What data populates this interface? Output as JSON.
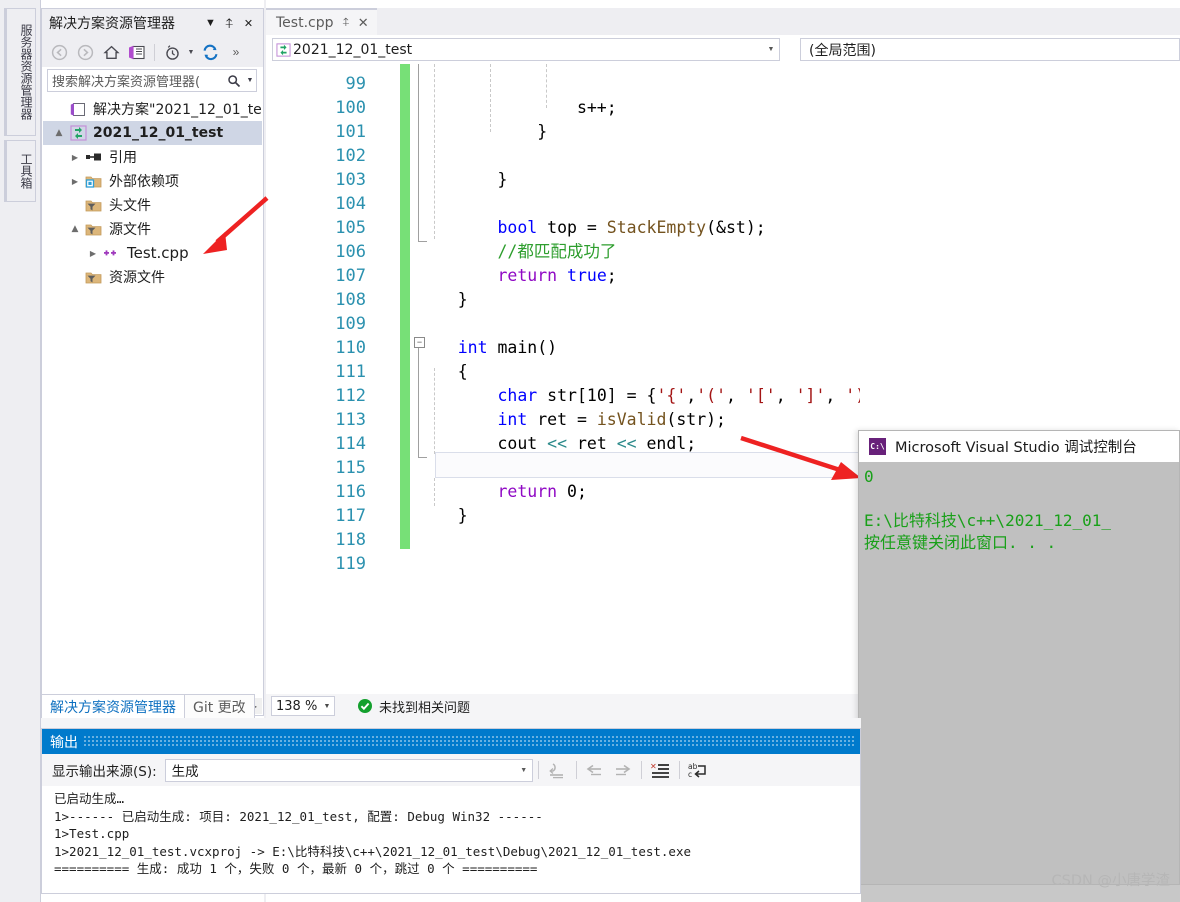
{
  "left_dock": {
    "tabs": [
      {
        "name": "server-explorer",
        "label": "服务器资源管理器"
      },
      {
        "name": "toolbox",
        "label": "工具箱"
      }
    ]
  },
  "solution_explorer": {
    "title": "解决方案资源管理器",
    "header_buttons": [
      {
        "name": "dropdown",
        "glyph": "▼"
      },
      {
        "name": "pin",
        "glyph": "⇱"
      },
      {
        "name": "close",
        "glyph": "✕"
      }
    ],
    "toolbar": [
      {
        "name": "back",
        "glyph": "◀"
      },
      {
        "name": "forward",
        "glyph": "▶"
      },
      {
        "name": "home",
        "glyph": "⌂"
      },
      {
        "name": "solution-view",
        "glyph": "▤"
      },
      {
        "name": "pending-changes",
        "glyph": "◷"
      },
      {
        "name": "refresh",
        "glyph": "⟳"
      },
      {
        "name": "overflow",
        "glyph": "»"
      }
    ],
    "search_placeholder": "搜索解决方案资源管理器(",
    "tree": [
      {
        "label": "解决方案\"2021_12_01_te",
        "icon": "solution-icon",
        "indent": 0,
        "arrow": "",
        "selected": false,
        "bold": false
      },
      {
        "label": "2021_12_01_test",
        "icon": "project-icon",
        "indent": 0,
        "arrow": "▲",
        "selected": true,
        "bold": true
      },
      {
        "label": "引用",
        "icon": "references-icon",
        "indent": 1,
        "arrow": "▶",
        "selected": false,
        "bold": false
      },
      {
        "label": "外部依赖项",
        "icon": "external-deps-icon",
        "indent": 1,
        "arrow": "▶",
        "selected": false,
        "bold": false
      },
      {
        "label": "头文件",
        "icon": "filter-folder-icon",
        "indent": 1,
        "arrow": "",
        "selected": false,
        "bold": false
      },
      {
        "label": "源文件",
        "icon": "filter-folder-icon",
        "indent": 1,
        "arrow": "▲",
        "selected": false,
        "bold": false
      },
      {
        "label": "Test.cpp",
        "icon": "cpp-file-icon",
        "indent": 2,
        "arrow": "▶",
        "selected": false,
        "bold": false
      },
      {
        "label": "资源文件",
        "icon": "filter-folder-icon",
        "indent": 1,
        "arrow": "",
        "selected": false,
        "bold": false
      }
    ]
  },
  "bottom_tabs": [
    {
      "label": "解决方案资源管理器",
      "active": true
    },
    {
      "label": "Git 更改",
      "active": false
    }
  ],
  "status_strip": {
    "zoom_value": "138 %",
    "status_text": "未找到相关问题",
    "status_icon": "check-circle-icon"
  },
  "document_tab": {
    "label": "Test.cpp",
    "pin_glyph": "⇱",
    "close_glyph": "✕"
  },
  "navbar": {
    "project": "2021_12_01_test",
    "scope": "(全局范围)"
  },
  "editor": {
    "first_line": 99,
    "lines": [
      {
        "num": 99,
        "segments": []
      },
      {
        "num": 100,
        "segments": [
          {
            "t": "                s++;",
            "c": "ident"
          }
        ]
      },
      {
        "num": 101,
        "segments": [
          {
            "t": "            }",
            "c": "ident"
          }
        ]
      },
      {
        "num": 102,
        "segments": []
      },
      {
        "num": 103,
        "segments": [
          {
            "t": "        }",
            "c": "ident"
          }
        ]
      },
      {
        "num": 104,
        "segments": []
      },
      {
        "num": 105,
        "segments": [
          {
            "t": "        ",
            "c": "ident"
          },
          {
            "t": "bool",
            "c": "kw"
          },
          {
            "t": " top = ",
            "c": "ident"
          },
          {
            "t": "StackEmpty",
            "c": "fn"
          },
          {
            "t": "(&st);",
            "c": "ident"
          }
        ]
      },
      {
        "num": 106,
        "segments": [
          {
            "t": "        ",
            "c": "ident"
          },
          {
            "t": "//都匹配成功了",
            "c": "cmt"
          }
        ]
      },
      {
        "num": 107,
        "segments": [
          {
            "t": "        ",
            "c": "ident"
          },
          {
            "t": "return",
            "c": "kw2"
          },
          {
            "t": " ",
            "c": "ident"
          },
          {
            "t": "true",
            "c": "kw"
          },
          {
            "t": ";",
            "c": "ident"
          }
        ]
      },
      {
        "num": 108,
        "segments": [
          {
            "t": "    }",
            "c": "ident"
          }
        ]
      },
      {
        "num": 109,
        "segments": []
      },
      {
        "num": 110,
        "segments": [
          {
            "t": "    ",
            "c": "ident"
          },
          {
            "t": "int",
            "c": "kw"
          },
          {
            "t": " ",
            "c": "ident"
          },
          {
            "t": "main",
            "c": "ident"
          },
          {
            "t": "()",
            "c": "ident"
          }
        ]
      },
      {
        "num": 111,
        "segments": [
          {
            "t": "    {",
            "c": "ident"
          }
        ]
      },
      {
        "num": 112,
        "segments": [
          {
            "t": "        ",
            "c": "ident"
          },
          {
            "t": "char",
            "c": "kw"
          },
          {
            "t": " str[",
            "c": "ident"
          },
          {
            "t": "10",
            "c": "ident"
          },
          {
            "t": "] = {",
            "c": "ident"
          },
          {
            "t": "'{'",
            "c": "str"
          },
          {
            "t": ",",
            "c": "ident"
          },
          {
            "t": "'('",
            "c": "str"
          },
          {
            "t": ", ",
            "c": "ident"
          },
          {
            "t": "'['",
            "c": "str"
          },
          {
            "t": ", ",
            "c": "ident"
          },
          {
            "t": "']'",
            "c": "str"
          },
          {
            "t": ", ",
            "c": "ident"
          },
          {
            "t": "')'",
            "c": "str"
          },
          {
            "t": ", ",
            "c": "ident"
          },
          {
            "t": "'}'",
            "c": "str"
          },
          {
            "t": "};",
            "c": "ident"
          }
        ]
      },
      {
        "num": 113,
        "segments": [
          {
            "t": "        ",
            "c": "ident"
          },
          {
            "t": "int",
            "c": "kw"
          },
          {
            "t": " ret = ",
            "c": "ident"
          },
          {
            "t": "isValid",
            "c": "fn"
          },
          {
            "t": "(str);",
            "c": "ident"
          }
        ]
      },
      {
        "num": 114,
        "segments": [
          {
            "t": "        cout ",
            "c": "ident"
          },
          {
            "t": "<<",
            "c": "teal"
          },
          {
            "t": " ret ",
            "c": "ident"
          },
          {
            "t": "<<",
            "c": "teal"
          },
          {
            "t": " endl;",
            "c": "ident"
          }
        ]
      },
      {
        "num": 115,
        "segments": []
      },
      {
        "num": 116,
        "segments": [
          {
            "t": "        ",
            "c": "ident"
          },
          {
            "t": "return",
            "c": "kw2"
          },
          {
            "t": " ",
            "c": "ident"
          },
          {
            "t": "0",
            "c": "ident"
          },
          {
            "t": ";",
            "c": "ident"
          }
        ]
      },
      {
        "num": 117,
        "segments": [
          {
            "t": "    }",
            "c": "ident"
          }
        ]
      },
      {
        "num": 118,
        "segments": []
      },
      {
        "num": 119,
        "segments": []
      }
    ],
    "fold_glyph": "−"
  },
  "console": {
    "title": "Microsoft Visual Studio 调试控制台",
    "icon_text": "C:\\",
    "lines": [
      "0",
      "",
      "E:\\比特科技\\c++\\2021_12_01_",
      "按任意键关闭此窗口. . ."
    ]
  },
  "output": {
    "title": "输出",
    "source_label": "显示输出来源(S):",
    "source_value": "生成",
    "toolbar_icons": [
      {
        "name": "find-message-icon",
        "glyph": "⤶"
      },
      {
        "name": "go-to-previous-icon",
        "glyph": "⇐"
      },
      {
        "name": "go-to-next-icon",
        "glyph": "⇒"
      },
      {
        "name": "clear-all-icon",
        "glyph": "✖"
      },
      {
        "name": "toggle-word-wrap-icon",
        "glyph": "⏎"
      }
    ],
    "lines": [
      "已启动生成…",
      "1>------ 已启动生成: 项目: 2021_12_01_test, 配置: Debug Win32 ------",
      "1>Test.cpp",
      "1>2021_12_01_test.vcxproj -> E:\\比特科技\\c++\\2021_12_01_test\\Debug\\2021_12_01_test.exe",
      "========== 生成: 成功 1 个，失败 0 个，最新 0 个，跳过 0 个 =========="
    ]
  },
  "watermark": "CSDN @小唐学渣",
  "colors": {
    "accent": "#007acc",
    "keyword": "#0000ff",
    "keyword_control": "#8f08c4",
    "comment": "#2e9e2e",
    "string": "#a31515",
    "function": "#74531f",
    "line_number": "#2b91af",
    "change_bar": "#77e077",
    "console_text": "#19a019",
    "arrow_red": "#ee2222"
  }
}
